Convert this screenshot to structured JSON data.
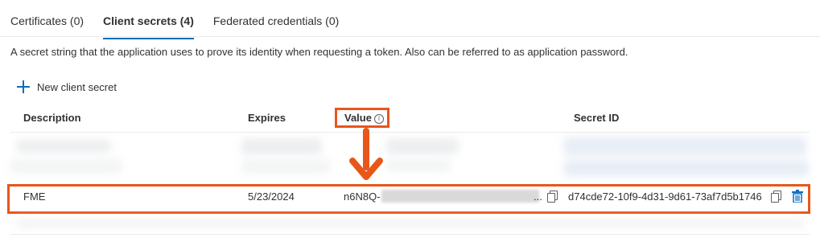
{
  "tabs": [
    {
      "label": "Certificates (0)"
    },
    {
      "label": "Client secrets (4)",
      "active": true
    },
    {
      "label": "Federated credentials (0)"
    }
  ],
  "description": "A secret string that the application uses to prove its identity when requesting a token. Also can be referred to as application password.",
  "toolbar": {
    "new_secret_label": "New client secret",
    "new_secret_icon": "plus-icon"
  },
  "table": {
    "columns": [
      "Description",
      "Expires",
      "Value",
      "Secret ID"
    ],
    "value_info_icon": "info-icon",
    "highlighted_row": {
      "description": "FME",
      "expires": "5/23/2024",
      "value_prefix": "n6N8Q-",
      "value_suffix": "...",
      "secret_id": "d74cde72-10f9-4d31-9d61-73af7d5b1746"
    }
  },
  "colors": {
    "accent": "#0f6cbd",
    "annotation": "#e8561a"
  }
}
